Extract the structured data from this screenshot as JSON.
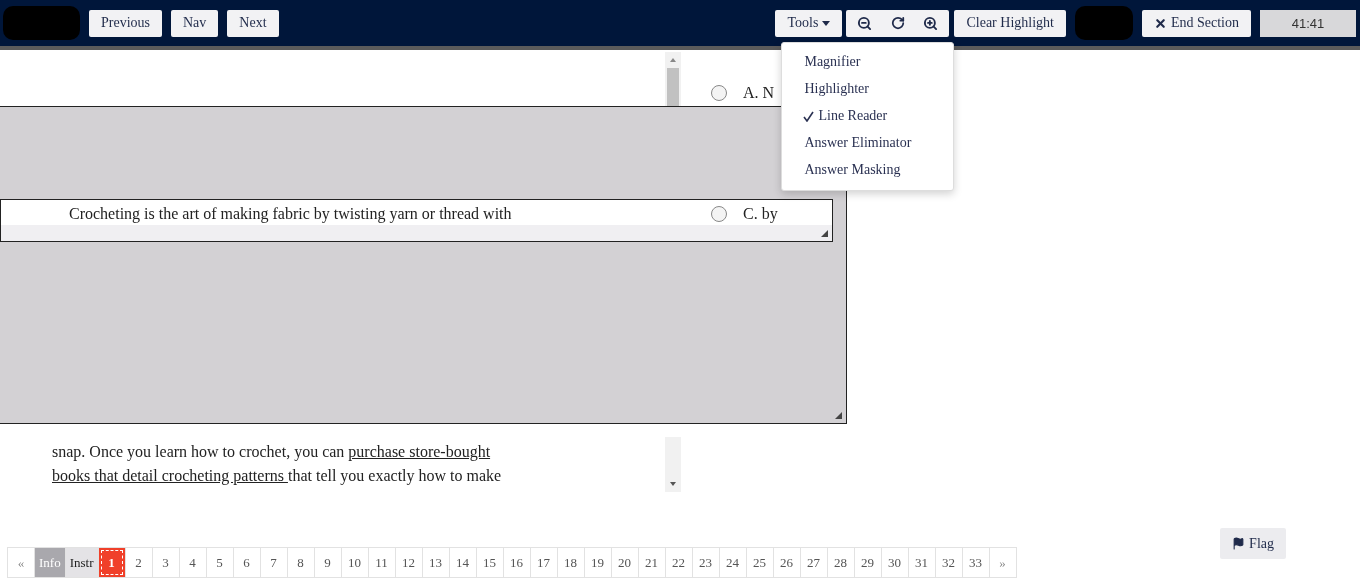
{
  "header": {
    "nav_buttons": [
      "Previous",
      "Nav",
      "Next"
    ],
    "tools_label": "Tools",
    "clear_highlight": "Clear Highlight",
    "end_section": "End Section",
    "timer": "41:41"
  },
  "tools_menu": {
    "expanded": true,
    "items": [
      {
        "label": "Magnifier",
        "checked": false
      },
      {
        "label": "Highlighter",
        "checked": false
      },
      {
        "label": "Line Reader",
        "checked": true
      },
      {
        "label": "Answer Eliminator",
        "checked": false
      },
      {
        "label": "Answer Masking",
        "checked": false
      }
    ]
  },
  "passage": {
    "window_line": "Crocheting is the art of making fabric by twisting yarn or thread with",
    "lines": [
      [
        {
          "text": "snap. Once you learn how to crochet, you can ",
          "link": false
        },
        {
          "text": "purchase store-bought",
          "link": true
        }
      ],
      [
        {
          "text": "books that detail crocheting patterns ",
          "link": true
        },
        {
          "text": "that tell you exactly how to make",
          "link": false
        }
      ]
    ]
  },
  "answers": [
    {
      "label": "A. N",
      "selected": false
    },
    {
      "label": "C. by",
      "selected": false
    }
  ],
  "flag_button": "Flag",
  "pagination": {
    "prev": "«",
    "next": "»",
    "items": [
      {
        "label": "Info",
        "kind": "section",
        "disabled": true,
        "selected": false
      },
      {
        "label": "Instr",
        "kind": "section",
        "disabled": false,
        "selected": false
      },
      {
        "label": "1",
        "kind": "page",
        "selected": true
      },
      {
        "label": "2",
        "kind": "page",
        "selected": false
      },
      {
        "label": "3",
        "kind": "page",
        "selected": false
      },
      {
        "label": "4",
        "kind": "page",
        "selected": false
      },
      {
        "label": "5",
        "kind": "page",
        "selected": false
      },
      {
        "label": "6",
        "kind": "page",
        "selected": false
      },
      {
        "label": "7",
        "kind": "page",
        "selected": false
      },
      {
        "label": "8",
        "kind": "page",
        "selected": false
      },
      {
        "label": "9",
        "kind": "page",
        "selected": false
      },
      {
        "label": "10",
        "kind": "page",
        "selected": false
      },
      {
        "label": "11",
        "kind": "page",
        "selected": false
      },
      {
        "label": "12",
        "kind": "page",
        "selected": false
      },
      {
        "label": "13",
        "kind": "page",
        "selected": false
      },
      {
        "label": "14",
        "kind": "page",
        "selected": false
      },
      {
        "label": "15",
        "kind": "page",
        "selected": false
      },
      {
        "label": "16",
        "kind": "page",
        "selected": false
      },
      {
        "label": "17",
        "kind": "page",
        "selected": false
      },
      {
        "label": "18",
        "kind": "page",
        "selected": false
      },
      {
        "label": "19",
        "kind": "page",
        "selected": false
      },
      {
        "label": "20",
        "kind": "page",
        "selected": false
      },
      {
        "label": "21",
        "kind": "page",
        "selected": false
      },
      {
        "label": "22",
        "kind": "page",
        "selected": false
      },
      {
        "label": "23",
        "kind": "page",
        "selected": false
      },
      {
        "label": "24",
        "kind": "page",
        "selected": false
      },
      {
        "label": "25",
        "kind": "page",
        "selected": false
      },
      {
        "label": "26",
        "kind": "page",
        "selected": false
      },
      {
        "label": "27",
        "kind": "page",
        "selected": false
      },
      {
        "label": "28",
        "kind": "page",
        "selected": false
      },
      {
        "label": "29",
        "kind": "page",
        "selected": false
      },
      {
        "label": "30",
        "kind": "page",
        "selected": false
      },
      {
        "label": "31",
        "kind": "page",
        "selected": false
      },
      {
        "label": "32",
        "kind": "page",
        "selected": false
      },
      {
        "label": "33",
        "kind": "page",
        "selected": false
      }
    ]
  }
}
